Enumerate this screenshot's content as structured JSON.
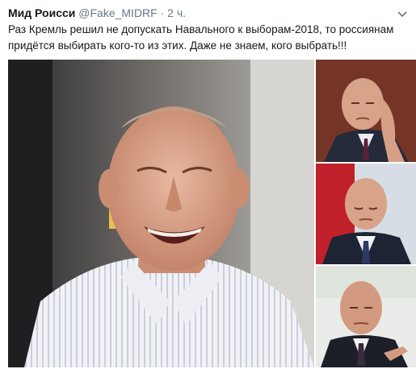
{
  "tweet": {
    "author_name": "Мид Роисси",
    "handle": "@Fake_MIDRF",
    "separator": "·",
    "time": "2 ч.",
    "text": "Раз Кремль решил не допускать Навального к выборам-2018, то россиянам придётся выбирать кого-то из этих. Даже не знаем, кого выбрать!!!"
  },
  "icons": {
    "more_menu": "chevron-down-icon"
  },
  "media": {
    "photos": [
      {
        "subject": "laughing man in striped shirt"
      },
      {
        "subject": "man resting head on hand"
      },
      {
        "subject": "man in suit looking down, red background"
      },
      {
        "subject": "man in suit pointing, speaking"
      }
    ]
  },
  "colors": {
    "name": "#14171a",
    "secondary": "#657786"
  }
}
